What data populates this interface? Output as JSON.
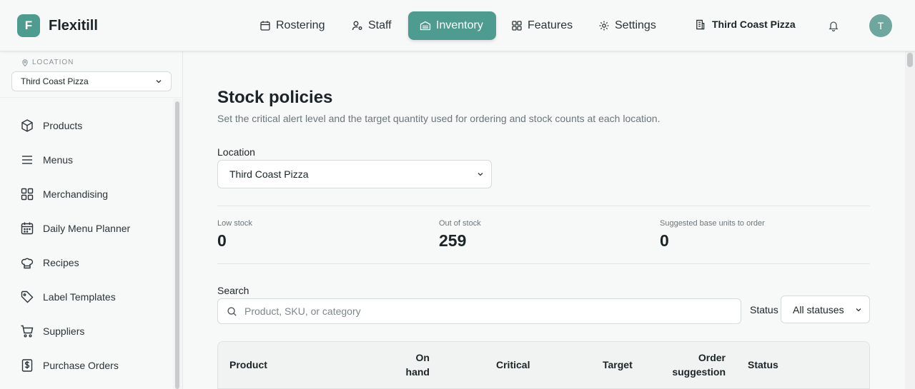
{
  "app": {
    "logo_letter": "F",
    "brand": "Flexitill"
  },
  "nav": {
    "items": [
      {
        "label": "Rostering",
        "icon": "calendar-icon"
      },
      {
        "label": "Staff",
        "icon": "user-gear-icon"
      },
      {
        "label": "Inventory",
        "icon": "inventory-icon",
        "active": true
      },
      {
        "label": "Features",
        "icon": "grid-icon"
      },
      {
        "label": "Settings",
        "icon": "gear-icon"
      }
    ],
    "location": "Third Coast Pizza",
    "avatar_letter": "T"
  },
  "sidebar": {
    "location_label": "LOCATION",
    "location_value": "Third Coast Pizza",
    "items": [
      {
        "label": "Products",
        "icon": "box-icon"
      },
      {
        "label": "Menus",
        "icon": "menu-lines-icon"
      },
      {
        "label": "Merchandising",
        "icon": "grid-icon"
      },
      {
        "label": "Daily Menu Planner",
        "icon": "calendar-icon"
      },
      {
        "label": "Recipes",
        "icon": "chef-hat-icon"
      },
      {
        "label": "Label Templates",
        "icon": "tag-icon"
      },
      {
        "label": "Suppliers",
        "icon": "cart-icon"
      },
      {
        "label": "Purchase Orders",
        "icon": "dollar-doc-icon"
      }
    ]
  },
  "page": {
    "title": "Stock policies",
    "subtitle": "Set the critical alert level and the target quantity used for ordering and stock counts at each location.",
    "location_label": "Location",
    "location_value": "Third Coast Pizza",
    "stats": [
      {
        "label": "Low stock",
        "value": "0"
      },
      {
        "label": "Out of stock",
        "value": "259"
      },
      {
        "label": "Suggested base units to order",
        "value": "0"
      }
    ],
    "search_label": "Search",
    "search_placeholder": "Product, SKU, or category",
    "status_label": "Status",
    "status_value": "All statuses",
    "table": {
      "columns": {
        "product": "Product",
        "on_hand_1": "On",
        "on_hand_2": "hand",
        "critical": "Critical",
        "target": "Target",
        "order_1": "Order",
        "order_2": "suggestion",
        "status": "Status"
      }
    }
  },
  "colors": {
    "accent": "#4e9c8f",
    "avatar": "#6fa79e"
  }
}
